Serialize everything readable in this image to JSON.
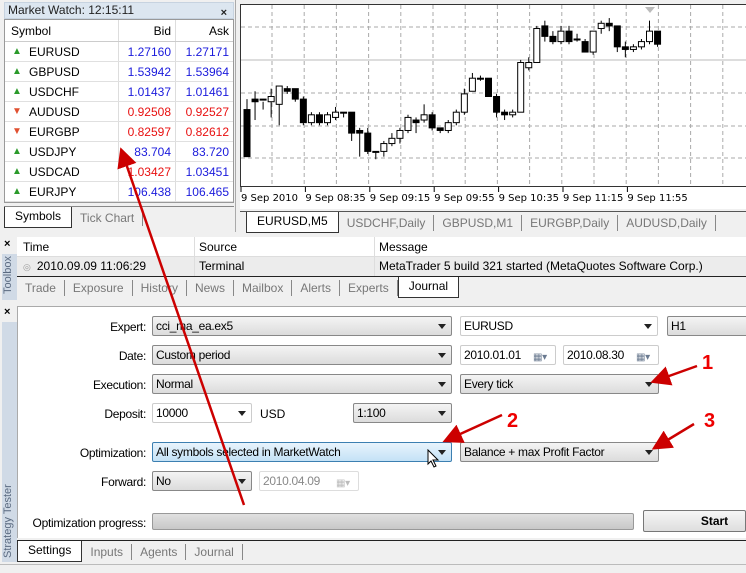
{
  "market_watch": {
    "title": "Market Watch: 12:15:11",
    "close": "×",
    "columns": {
      "symbol": "Symbol",
      "bid": "Bid",
      "ask": "Ask"
    },
    "rows": [
      {
        "symbol": "EURUSD",
        "dir": "up",
        "bid": "1.27160",
        "ask": "1.27171",
        "bid_color": "blue",
        "ask_color": "blue"
      },
      {
        "symbol": "GBPUSD",
        "dir": "up",
        "bid": "1.53942",
        "ask": "1.53964",
        "bid_color": "blue",
        "ask_color": "blue"
      },
      {
        "symbol": "USDCHF",
        "dir": "up",
        "bid": "1.01437",
        "ask": "1.01461",
        "bid_color": "blue",
        "ask_color": "blue"
      },
      {
        "symbol": "AUDUSD",
        "dir": "down",
        "bid": "0.92508",
        "ask": "0.92527",
        "bid_color": "red",
        "ask_color": "red"
      },
      {
        "symbol": "EURGBP",
        "dir": "down",
        "bid": "0.82597",
        "ask": "0.82612",
        "bid_color": "red",
        "ask_color": "red"
      },
      {
        "symbol": "USDJPY",
        "dir": "up",
        "bid": "83.704",
        "ask": "83.720",
        "bid_color": "blue",
        "ask_color": "blue"
      },
      {
        "symbol": "USDCAD",
        "dir": "up",
        "bid": "1.03427",
        "ask": "1.03451",
        "bid_color": "red",
        "ask_color": "blue"
      },
      {
        "symbol": "EURJPY",
        "dir": "up",
        "bid": "106.438",
        "ask": "106.465",
        "bid_color": "blue",
        "ask_color": "blue"
      }
    ],
    "tabs": [
      "Symbols",
      "Tick Chart"
    ],
    "active_tab": "Symbols"
  },
  "chart": {
    "time_labels": [
      "9 Sep 2010",
      "9 Sep 08:35",
      "9 Sep 09:15",
      "9 Sep 09:55",
      "9 Sep 10:35",
      "9 Sep 11:15",
      "9 Sep 11:55"
    ],
    "candles": [
      [
        40,
        22,
        22,
        44
      ],
      [
        44,
        43,
        36,
        47
      ],
      [
        44,
        44,
        40,
        43
      ],
      [
        43,
        45,
        37,
        48
      ],
      [
        42,
        49,
        34,
        49
      ],
      [
        48,
        47,
        46,
        49
      ],
      [
        48,
        44,
        43,
        48
      ],
      [
        44,
        35,
        34,
        45
      ],
      [
        35,
        38,
        34,
        39
      ],
      [
        38,
        35,
        34,
        39
      ],
      [
        35,
        38,
        34,
        39
      ],
      [
        37,
        39,
        36,
        41
      ],
      [
        39,
        39,
        37,
        39
      ],
      [
        39,
        31,
        28,
        39
      ],
      [
        32,
        31,
        22,
        33
      ],
      [
        31,
        24,
        23,
        33
      ],
      [
        24,
        24,
        21,
        24
      ],
      [
        24,
        27,
        22,
        28
      ],
      [
        27,
        29,
        26,
        31
      ],
      [
        29,
        32,
        27,
        33
      ],
      [
        32,
        37,
        31,
        38
      ],
      [
        36,
        35,
        31,
        37
      ],
      [
        36,
        38,
        35,
        42
      ],
      [
        38,
        33,
        32,
        39
      ],
      [
        33,
        32,
        31,
        33
      ],
      [
        32,
        35,
        31,
        36
      ],
      [
        35,
        39,
        34,
        40
      ],
      [
        39,
        46,
        38,
        48
      ],
      [
        47,
        52,
        47,
        54
      ],
      [
        52,
        52,
        51,
        53
      ],
      [
        52,
        45,
        45,
        52
      ],
      [
        45,
        39,
        37,
        46
      ],
      [
        39,
        38,
        36,
        40
      ],
      [
        38,
        39,
        37,
        40
      ],
      [
        39,
        58,
        57,
        59
      ],
      [
        56,
        58,
        55,
        60
      ],
      [
        58,
        71,
        58,
        72
      ],
      [
        72,
        68,
        66,
        74
      ],
      [
        68,
        66,
        65,
        70
      ],
      [
        66,
        70,
        65,
        72
      ],
      [
        70,
        66,
        65,
        72
      ],
      [
        67,
        67,
        66,
        69
      ],
      [
        66,
        62,
        62,
        67
      ],
      [
        62,
        70,
        61,
        70
      ],
      [
        71,
        73,
        69,
        74
      ],
      [
        73,
        72,
        70,
        75
      ],
      [
        72,
        64,
        62,
        72
      ],
      [
        64,
        63,
        60,
        66
      ],
      [
        63,
        64,
        62,
        65
      ],
      [
        64,
        66,
        63,
        67
      ],
      [
        66,
        70,
        65,
        74
      ],
      [
        70,
        65,
        64,
        70
      ]
    ]
  },
  "chart_tabs": [
    "EURUSD,M5",
    "USDCHF,Daily",
    "GBPUSD,M1",
    "EURGBP,Daily",
    "AUDUSD,Daily"
  ],
  "chart_active_tab": "EURUSD,M5",
  "toolbox": {
    "side_label": "Toolbox",
    "close": "×",
    "columns": {
      "time": "Time",
      "source": "Source",
      "message": "Message"
    },
    "row": {
      "time": "2010.09.09 11:06:29",
      "source": "Terminal",
      "message": "MetaTrader 5 build 321 started (MetaQuotes Software Corp.)"
    },
    "tabs": [
      "Trade",
      "Exposure",
      "History",
      "News",
      "Mailbox",
      "Alerts",
      "Experts",
      "Journal"
    ],
    "active_tab": "Journal"
  },
  "tester": {
    "side_label": "Strategy Tester",
    "close": "×",
    "labels": {
      "expert": "Expert:",
      "date": "Date:",
      "execution": "Execution:",
      "deposit": "Deposit:",
      "optimization": "Optimization:",
      "forward": "Forward:",
      "progress": "Optimization progress:"
    },
    "expert": "cci_ma_ea.ex5",
    "symbol": "EURUSD",
    "timeframe": "H1",
    "date_mode": "Custom period",
    "date_from": "2010.01.01",
    "date_to": "2010.08.30",
    "execution": "Normal",
    "ticks": "Every tick",
    "deposit": "10000",
    "currency": "USD",
    "leverage": "1:100",
    "optimization": "All symbols selected in MarketWatch",
    "criterion": "Balance + max Profit Factor",
    "forward": "No",
    "forward_date": "2010.04.09",
    "progress": 0,
    "start_label": "Start",
    "tabs": [
      "Settings",
      "Inputs",
      "Agents",
      "Journal"
    ],
    "active_tab": "Settings"
  },
  "annotations": [
    "1",
    "2",
    "3"
  ]
}
